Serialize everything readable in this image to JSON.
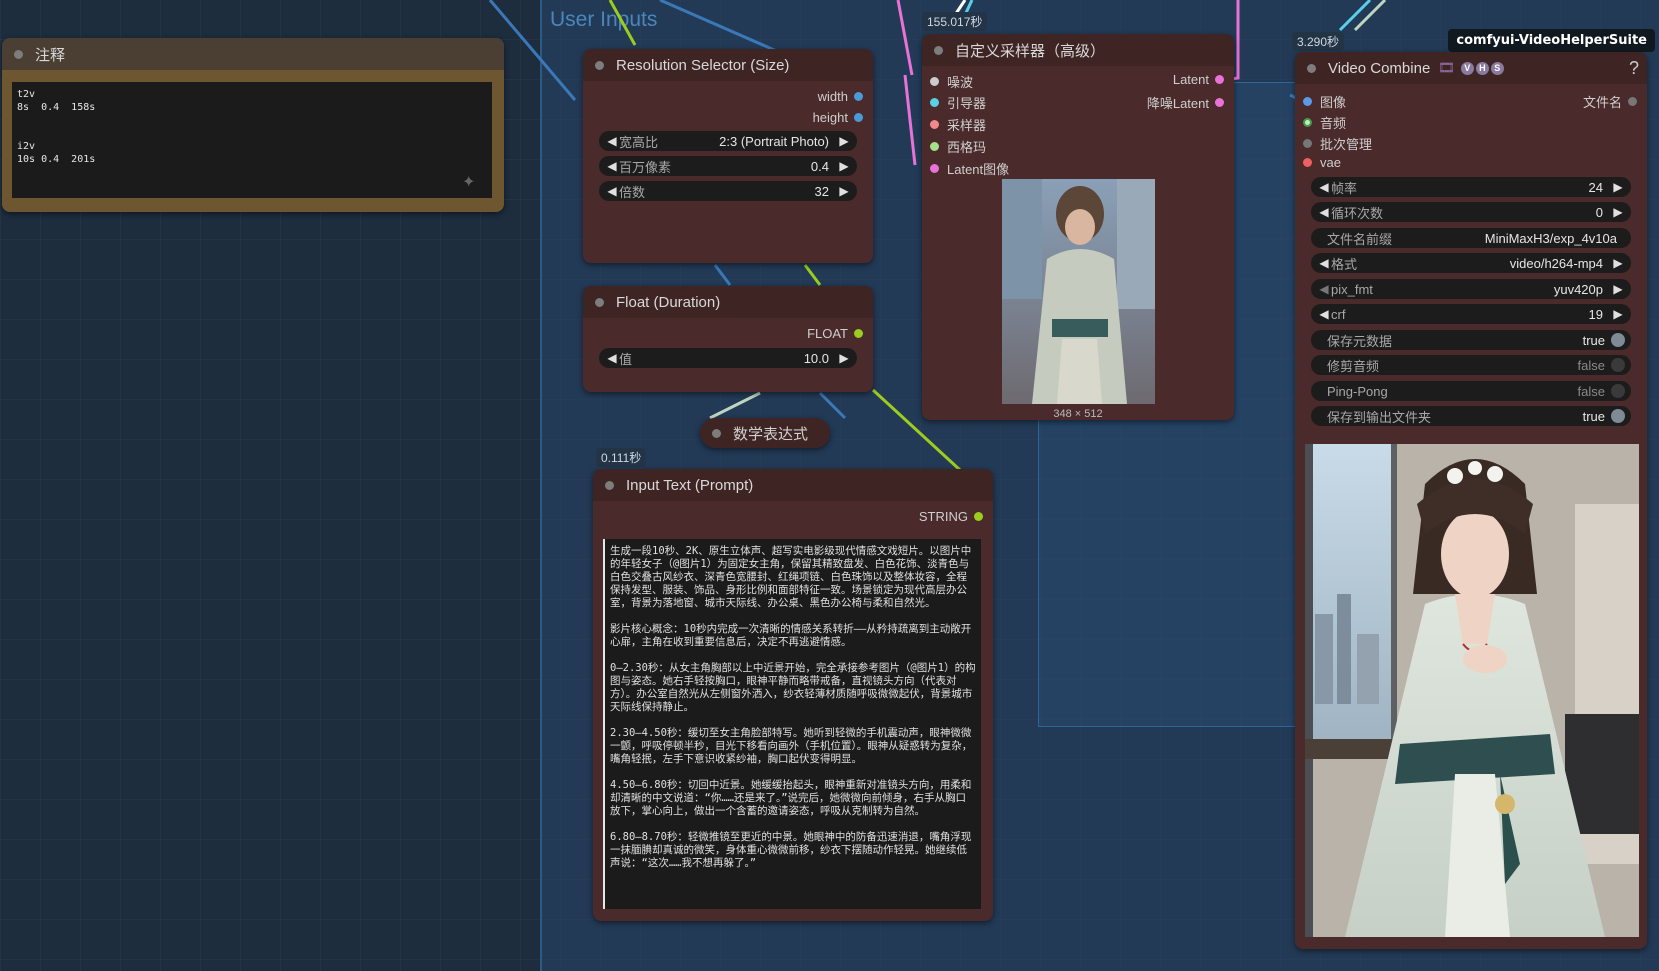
{
  "colors": {
    "canvas": "#1d2d3e",
    "group": "#264669",
    "node_body": "#4a2a2a",
    "node_header": "#3f2424",
    "note_body": "#6e5630",
    "wire_blue": "#3a78b8",
    "wire_green": "#9ccc1c",
    "wire_pink": "#e872d6",
    "wire_cyan": "#5ad0e8"
  },
  "group": {
    "title": "User Inputs"
  },
  "note": {
    "title": "注释",
    "text": "t2v\n8s  0.4  158s\n\n\ni2v\n10s 0.4  201s"
  },
  "resolution": {
    "title": "Resolution Selector (Size)",
    "outputs": [
      "width",
      "height"
    ],
    "widgets": [
      {
        "label": "宽高比",
        "value": "2:3 (Portrait Photo)"
      },
      {
        "label": "百万像素",
        "value": "0.4"
      },
      {
        "label": "倍数",
        "value": "32"
      }
    ]
  },
  "float_node": {
    "title": "Float (Duration)",
    "output": "FLOAT",
    "widget": {
      "label": "值",
      "value": "10.0"
    }
  },
  "math_node": {
    "title": "数学表达式"
  },
  "prompt_node": {
    "timing": "0.111秒",
    "title": "Input Text (Prompt)",
    "output": "STRING",
    "text": "生成一段10秒、2K、原生立体声、超写实电影级现代情感文戏短片。以图片中的年轻女子（@图片1）为固定女主角，保留其精致盘发、白色花饰、淡青色与白色交叠古风纱衣、深青色宽腰封、红绳项链、白色珠饰以及整体妆容，全程保持发型、服装、饰品、身形比例和面部特征一致。场景锁定为现代高层办公室，背景为落地窗、城市天际线、办公桌、黑色办公椅与柔和自然光。\n\n影片核心概念：10秒内完成一次清晰的情感关系转折——从矜持疏离到主动敞开心扉，主角在收到重要信息后，决定不再逃避情感。\n\n0—2.30秒：从女主角胸部以上中近景开始，完全承接参考图片（@图片1）的构图与姿态。她右手轻按胸口，眼神平静而略带戒备，直视镜头方向（代表对方）。办公室自然光从左侧窗外洒入，纱衣轻薄材质随呼吸微微起伏，背景城市天际线保持静止。\n\n2.30—4.50秒：缓切至女主角脸部特写。她听到轻微的手机震动声，眼神微微一颤，呼吸停顿半秒，目光下移看向画外（手机位置）。眼神从疑惑转为复杂，嘴角轻抿，左手下意识收紧纱袖，胸口起伏变得明显。\n\n4.50—6.80秒：切回中近景。她缓缓抬起头，眼神重新对准镜头方向，用柔和却清晰的中文说道：“你……还是来了。”说完后，她微微向前倾身，右手从胸口放下，掌心向上，做出一个含蓄的邀请姿态，呼吸从克制转为自然。\n\n6.80—8.70秒：轻微推镜至更近的中景。她眼神中的防备迅速消退，嘴角浮现一抹腼腆却真诚的微笑，身体重心微微前移，纱衣下摆随动作轻晃。她继续低声说：“这次……我不想再躲了。”"
  },
  "sampler": {
    "timing": "155.017秒",
    "title": "自定义采样器（高级）",
    "inputs": [
      "噪波",
      "引导器",
      "采样器",
      "西格玛",
      "Latent图像"
    ],
    "outputs": [
      "Latent",
      "降噪Latent"
    ],
    "preview_caption": "348 × 512"
  },
  "video": {
    "timing": "3.290秒",
    "badge": "comfyui-VideoHelperSuite",
    "title": "Video Combine",
    "help": "?",
    "vhs_badges": [
      "V",
      "H",
      "S"
    ],
    "inputs": [
      "图像",
      "音频",
      "批次管理",
      "vae"
    ],
    "output": "文件名",
    "widgets": [
      {
        "label": "帧率",
        "value": "24",
        "kind": "number"
      },
      {
        "label": "循环次数",
        "value": "0",
        "kind": "number"
      },
      {
        "label": "文件名前缀",
        "value": "MiniMaxH3/exp_4v10a",
        "kind": "text"
      },
      {
        "label": "格式",
        "value": "video/h264-mp4",
        "kind": "combo"
      },
      {
        "label": "pix_fmt",
        "value": "yuv420p",
        "kind": "combo"
      },
      {
        "label": "crf",
        "value": "19",
        "kind": "number"
      },
      {
        "label": "保存元数据",
        "value": "true",
        "kind": "toggle"
      },
      {
        "label": "修剪音频",
        "value": "false",
        "kind": "toggle"
      },
      {
        "label": "Ping-Pong",
        "value": "false",
        "kind": "toggle"
      },
      {
        "label": "保存到输出文件夹",
        "value": "true",
        "kind": "toggle"
      }
    ]
  }
}
